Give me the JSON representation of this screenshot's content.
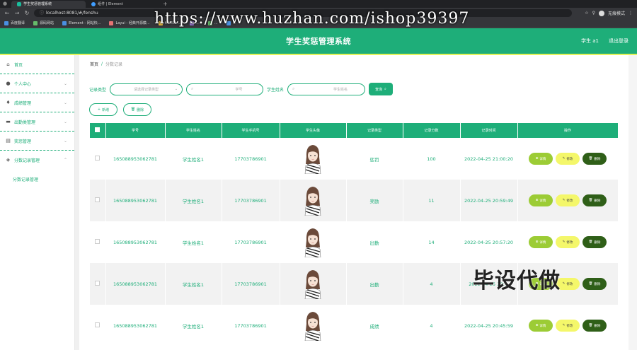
{
  "browser": {
    "tabs": [
      {
        "label": "学生奖惩管理系统",
        "active": true
      },
      {
        "label": "组件 | Element",
        "active": false
      }
    ],
    "url": "localhost:8081/#/fenshu",
    "profile_label": "无痕模式",
    "bookmarks": [
      "百度翻译",
      "源码网站",
      "Element - 网站快...",
      "Layui - 经典开源模...",
      "HTML5 ...",
      "...",
      "...",
      "..."
    ],
    "watermark": "https://www.huzhan.com/ishop39397"
  },
  "header": {
    "title": "学生奖惩管理系统",
    "user": "学生 a1",
    "logout": "退出登录"
  },
  "sidebar": {
    "items": [
      {
        "label": "首页",
        "icon": "home-icon",
        "has_chevron": false
      },
      {
        "label": "个人中心",
        "icon": "user-icon",
        "has_chevron": true
      },
      {
        "label": "成绩管理",
        "icon": "score-icon",
        "has_chevron": true
      },
      {
        "label": "出勤类管理",
        "icon": "attendance-icon",
        "has_chevron": true
      },
      {
        "label": "奖惩管理",
        "icon": "reward-icon",
        "has_chevron": true
      },
      {
        "label": "分数记录管理",
        "icon": "record-icon",
        "has_chevron": true
      }
    ],
    "sub_item": "分数记录管理"
  },
  "breadcrumb": {
    "home": "首页",
    "separator": "/",
    "current": "分数记录"
  },
  "filter": {
    "type_label": "记录类型",
    "type_placeholder": "请选择记录类型",
    "id_label": "学号",
    "id_placeholder": "学号",
    "name_label": "学生姓名",
    "name_placeholder": "学生姓名",
    "search_label": "查询"
  },
  "actions": {
    "add_label": "新增",
    "delete_label": "删除"
  },
  "table": {
    "columns": [
      "学号",
      "学生姓名",
      "学生手机号",
      "学生头像",
      "记录类型",
      "记录分数",
      "记录时间",
      "操作"
    ],
    "rows": [
      {
        "id": "165088953062781",
        "name": "学生姓名1",
        "phone": "17703786901",
        "type": "惩罚",
        "score": "100",
        "time": "2022-04-25 21:00:20"
      },
      {
        "id": "165088953062781",
        "name": "学生姓名1",
        "phone": "17703786901",
        "type": "奖励",
        "score": "11",
        "time": "2022-04-25 20:59:49"
      },
      {
        "id": "165088953062781",
        "name": "学生姓名1",
        "phone": "17703786901",
        "type": "出勤",
        "score": "14",
        "time": "2022-04-25 20:57:20"
      },
      {
        "id": "165088953062781",
        "name": "学生姓名1",
        "phone": "17703786901",
        "type": "出勤",
        "score": "4",
        "time": "2022-04-25 20:..."
      },
      {
        "id": "165088953062781",
        "name": "学生姓名1",
        "phone": "17703786901",
        "type": "成绩",
        "score": "4",
        "time": "2022-04-25 20:45:59"
      }
    ],
    "op_detail": "详情",
    "op_edit": "修改",
    "op_delete": "删除"
  },
  "overlay_text": "毕设代做",
  "colors": {
    "primary": "#1eae79",
    "accent_yellow": "#e6f35a",
    "detail_btn": "#9ccc35",
    "edit_btn": "#f4f76a",
    "delete_btn": "#2f5f18"
  }
}
